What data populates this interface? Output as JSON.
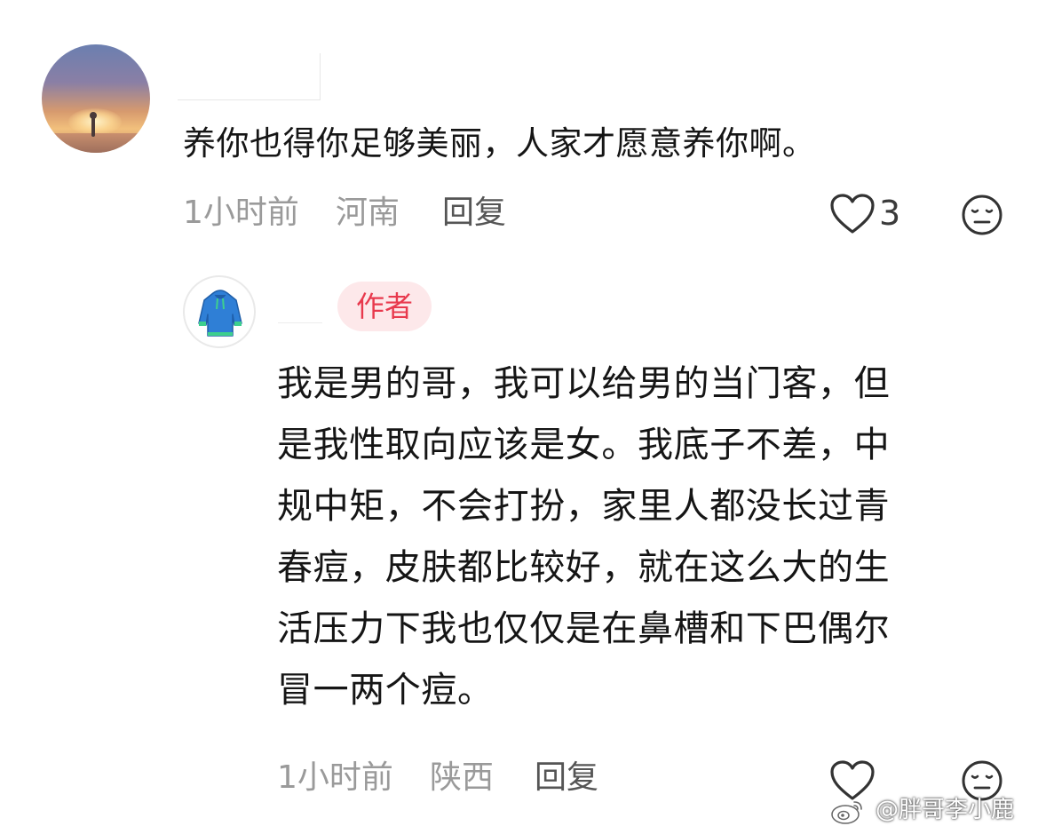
{
  "comments": [
    {
      "text": "养你也得你足够美丽，人家才愿意养你啊。",
      "time": "1小时前",
      "location": "河南",
      "reply_label": "回复",
      "like_count": "3"
    },
    {
      "author_badge": "作者",
      "lines": [
        "我是男的哥，我可以给男的当门客，但",
        "是我性取向应该是女。我底子不差，中",
        "规中矩，不会打扮，家里人都没长过青",
        "春痘，皮肤都比较好，就在这么大的生",
        "活压力下我也仅仅是在鼻槽和下巴偶尔",
        "冒一两个痘。"
      ],
      "time": "1小时前",
      "location": "陕西",
      "reply_label": "回复"
    }
  ],
  "watermark": "@胖哥李小鹿",
  "icons": {
    "like": "heart-outline-icon",
    "dislike": "meh-face-icon",
    "avatar2": "hoodie-icon"
  },
  "colors": {
    "badge_text": "#e8394d",
    "badge_bg": "#fde8ea",
    "meta_gray": "#9a9a9a"
  }
}
